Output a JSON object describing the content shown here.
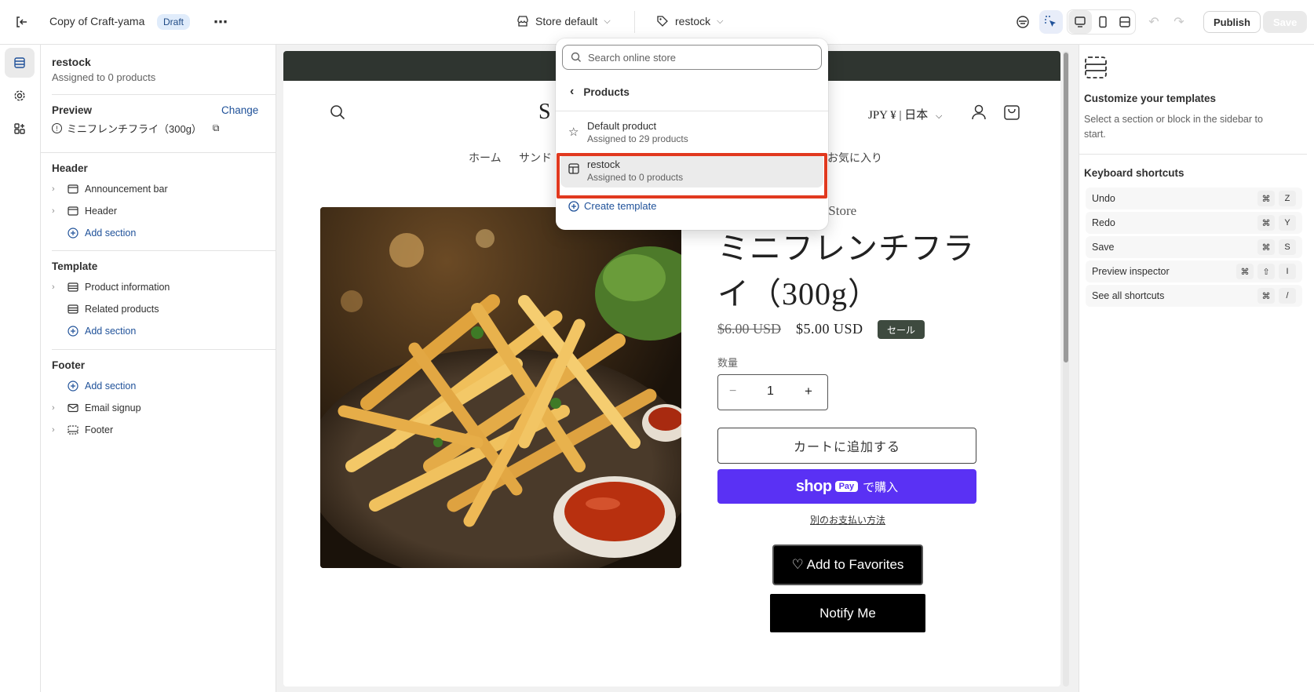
{
  "topbar": {
    "doc_title": "Copy of Craft-yama",
    "status_badge": "Draft",
    "theme_selector": "Store default",
    "template_selector": "restock",
    "publish_label": "Publish",
    "save_label": "Save"
  },
  "sidebar": {
    "template_name": "restock",
    "template_sub": "Assigned to 0 products",
    "preview_label": "Preview",
    "change_label": "Change",
    "preview_product": "ミニフレンチフライ（300g）",
    "header_group": {
      "title": "Header",
      "items": [
        "Announcement bar",
        "Header"
      ],
      "add_section": "Add section"
    },
    "template_group": {
      "title": "Template",
      "items": [
        "Product information",
        "Related products"
      ],
      "add_section": "Add section"
    },
    "footer_group": {
      "title": "Footer",
      "add_section": "Add section",
      "items": [
        "Email signup",
        "Footer"
      ]
    }
  },
  "store": {
    "logo_partial": "S",
    "currency": "JPY ¥ | 日本",
    "nav": [
      "ホーム",
      "サンド",
      "お気に入り"
    ],
    "vendor_partial": "ndwich Store",
    "product_title": "ミニフレンチフラ\nイ（300g）",
    "price_old": "$6.00 USD",
    "price_new": "$5.00 USD",
    "sale_badge": "セール",
    "qty_label": "数量",
    "qty_value": "1",
    "add_to_cart": "カートに追加する",
    "shop_pay": "shop",
    "shop_pay_pill": "Pay",
    "shop_pay_buy": "で購入",
    "other_payment": "別のお支払い方法",
    "favorites": "♡ Add to Favorites",
    "notify": "Notify Me"
  },
  "dropdown": {
    "search_placeholder": "Search online store",
    "back_label": "Products",
    "items": [
      {
        "title": "Default product",
        "sub": "Assigned to 29 products"
      },
      {
        "title": "restock",
        "sub": "Assigned to 0 products"
      }
    ],
    "create_label": "Create template"
  },
  "rightpanel": {
    "title": "Customize your templates",
    "desc": "Select a section or block in the sidebar to start.",
    "shortcuts_title": "Keyboard shortcuts",
    "shortcuts": [
      {
        "label": "Undo",
        "keys": [
          "⌘",
          "Z"
        ]
      },
      {
        "label": "Redo",
        "keys": [
          "⌘",
          "Y"
        ]
      },
      {
        "label": "Save",
        "keys": [
          "⌘",
          "S"
        ]
      },
      {
        "label": "Preview inspector",
        "keys": [
          "⌘",
          "⇧",
          "I"
        ]
      },
      {
        "label": "See all shortcuts",
        "keys": [
          "⌘",
          "/"
        ]
      }
    ]
  },
  "colors": {
    "accent_highlight": "#e1391f",
    "shop_pay": "#5a31f4",
    "announcement_bar": "#2f3530",
    "link": "#1f5199"
  }
}
